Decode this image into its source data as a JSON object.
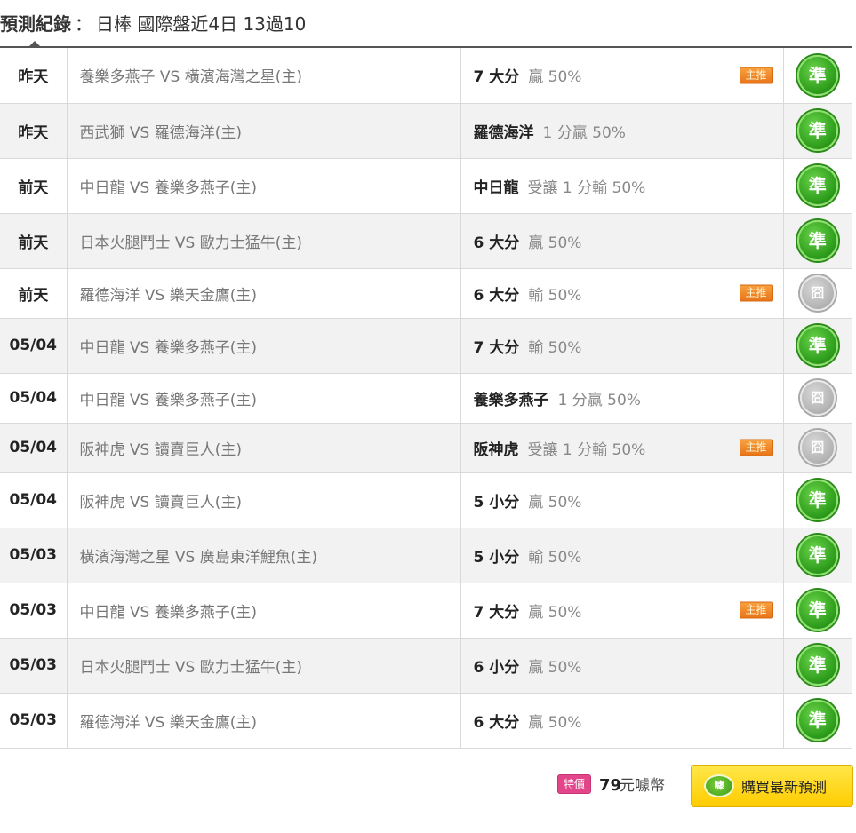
{
  "header": {
    "title": "預測紀錄",
    "separator": "：",
    "summary": "日棒 國際盤近4日 13過10"
  },
  "rows": [
    {
      "date": "昨天",
      "match": "養樂多燕子 VS 橫濱海灣之星(主)",
      "pick": "7 大分",
      "odds": "贏 50%",
      "main_tag": "主推",
      "result": "準",
      "result_type": "win"
    },
    {
      "date": "昨天",
      "match": "西武獅 VS 羅德海洋(主)",
      "pick": "羅德海洋",
      "odds": "1 分贏 50%",
      "main_tag": "",
      "result": "準",
      "result_type": "win"
    },
    {
      "date": "前天",
      "match": "中日龍 VS 養樂多燕子(主)",
      "pick": "中日龍",
      "odds": "受讓 1 分輸 50%",
      "main_tag": "",
      "result": "準",
      "result_type": "win"
    },
    {
      "date": "前天",
      "match": "日本火腿鬥士 VS 歐力士猛牛(主)",
      "pick": "6 大分",
      "odds": "贏 50%",
      "main_tag": "",
      "result": "準",
      "result_type": "win"
    },
    {
      "date": "前天",
      "match": "羅德海洋 VS 樂天金鷹(主)",
      "pick": "6 大分",
      "odds": "輸 50%",
      "main_tag": "主推",
      "result": "囧",
      "result_type": "push"
    },
    {
      "date": "05/04",
      "match": "中日龍 VS 養樂多燕子(主)",
      "pick": "7 大分",
      "odds": "輸 50%",
      "main_tag": "",
      "result": "準",
      "result_type": "win"
    },
    {
      "date": "05/04",
      "match": "中日龍 VS 養樂多燕子(主)",
      "pick": "養樂多燕子",
      "odds": "1 分贏 50%",
      "main_tag": "",
      "result": "囧",
      "result_type": "push"
    },
    {
      "date": "05/04",
      "match": "阪神虎 VS 讀賣巨人(主)",
      "pick": "阪神虎",
      "odds": "受讓 1 分輸 50%",
      "main_tag": "主推",
      "result": "囧",
      "result_type": "push"
    },
    {
      "date": "05/04",
      "match": "阪神虎 VS 讀賣巨人(主)",
      "pick": "5 小分",
      "odds": "贏 50%",
      "main_tag": "",
      "result": "準",
      "result_type": "win"
    },
    {
      "date": "05/03",
      "match": "橫濱海灣之星 VS 廣島東洋鯉魚(主)",
      "pick": "5 小分",
      "odds": "輸 50%",
      "main_tag": "",
      "result": "準",
      "result_type": "win"
    },
    {
      "date": "05/03",
      "match": "中日龍 VS 養樂多燕子(主)",
      "pick": "7 大分",
      "odds": "贏 50%",
      "main_tag": "主推",
      "result": "準",
      "result_type": "win"
    },
    {
      "date": "05/03",
      "match": "日本火腿鬥士 VS 歐力士猛牛(主)",
      "pick": "6 小分",
      "odds": "贏 50%",
      "main_tag": "",
      "result": "準",
      "result_type": "win"
    },
    {
      "date": "05/03",
      "match": "羅德海洋 VS 樂天金鷹(主)",
      "pick": "6 大分",
      "odds": "贏 50%",
      "main_tag": "",
      "result": "準",
      "result_type": "win"
    }
  ],
  "footer": {
    "special_tag": "特價",
    "price": "79",
    "price_unit": "元噱幣",
    "buy_icon_text": "噱",
    "buy_label": "購買最新預測"
  },
  "colors": {
    "win_badge": "#2e9e1c",
    "push_badge": "#b5b5b5",
    "main_tag": "#e8761a",
    "special_tag": "#e2458a",
    "buy_button": "#ffcc00"
  },
  "icons": {
    "win": "green-circle-badge",
    "push": "grey-circle-badge",
    "buy": "coin-icon"
  }
}
